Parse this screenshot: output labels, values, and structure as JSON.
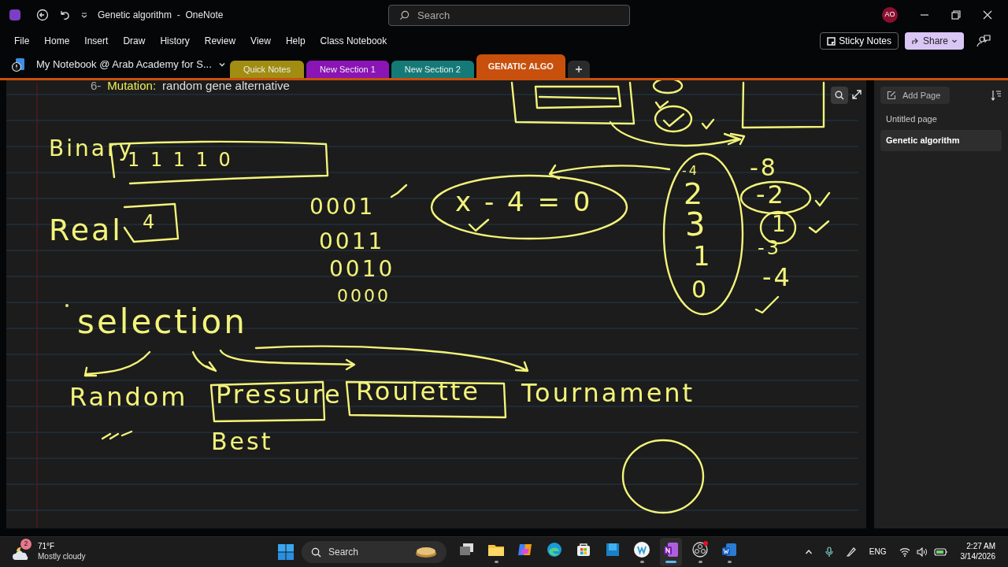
{
  "window": {
    "title": "Genetic algorithm  -  OneNote",
    "search_placeholder": "Search",
    "account_initials": "AO"
  },
  "menu": [
    "File",
    "Home",
    "Insert",
    "Draw",
    "History",
    "Review",
    "View",
    "Help",
    "Class Notebook"
  ],
  "ribbon_buttons": {
    "sticky_notes": "Sticky Notes",
    "share": "Share"
  },
  "notebook": {
    "name": "My Notebook @ Arab Academy for S..."
  },
  "section_tabs": [
    {
      "label": "Quick Notes",
      "color": "#a08d12",
      "selected": false
    },
    {
      "label": "New Section 1",
      "color": "#8b14b4",
      "selected": false
    },
    {
      "label": "New Section 2",
      "color": "#147a78",
      "selected": false
    },
    {
      "label": "GENATIC ALGO",
      "color": "#c8500c",
      "selected": true
    }
  ],
  "page": {
    "typed_line": {
      "number": "6-",
      "term": "Mutation:",
      "text": "random gene alternative"
    },
    "ink": [
      "Binary",
      "1 1 1 1 0",
      "Real",
      "4",
      "0001",
      "0011",
      "x - 4 = 0",
      "0010",
      "0000",
      "-4",
      "2",
      "3",
      "1",
      "0",
      "-8",
      "-2",
      "1",
      "-3",
      "-4",
      "selection",
      "Random",
      "Pressure",
      "Roulette",
      "Tournament",
      "Best"
    ]
  },
  "pages_pane": {
    "add_page": "Add Page",
    "pages": [
      {
        "title": "Untitled page",
        "selected": false
      },
      {
        "title": "Genetic algorithm",
        "selected": true
      }
    ]
  },
  "taskbar": {
    "weather": {
      "badge": "2",
      "temperature": "71°F",
      "condition": "Mostly cloudy"
    },
    "search_placeholder": "Search",
    "apps": [
      {
        "kind": "taskview",
        "running": false,
        "selected": false
      },
      {
        "kind": "explorer",
        "running": true,
        "selected": false
      },
      {
        "kind": "copilot",
        "running": false,
        "selected": false
      },
      {
        "kind": "edge",
        "running": false,
        "selected": false
      },
      {
        "kind": "store",
        "running": false,
        "selected": false
      },
      {
        "kind": "bluebox",
        "running": false,
        "selected": false
      },
      {
        "kind": "wcircle",
        "running": true,
        "selected": false
      },
      {
        "kind": "onenote",
        "running": true,
        "selected": true
      },
      {
        "kind": "obs",
        "running": true,
        "selected": false
      },
      {
        "kind": "word",
        "running": true,
        "selected": false
      }
    ],
    "language": "ENG",
    "time": "2:27 AM",
    "date": "3/14/2026"
  }
}
